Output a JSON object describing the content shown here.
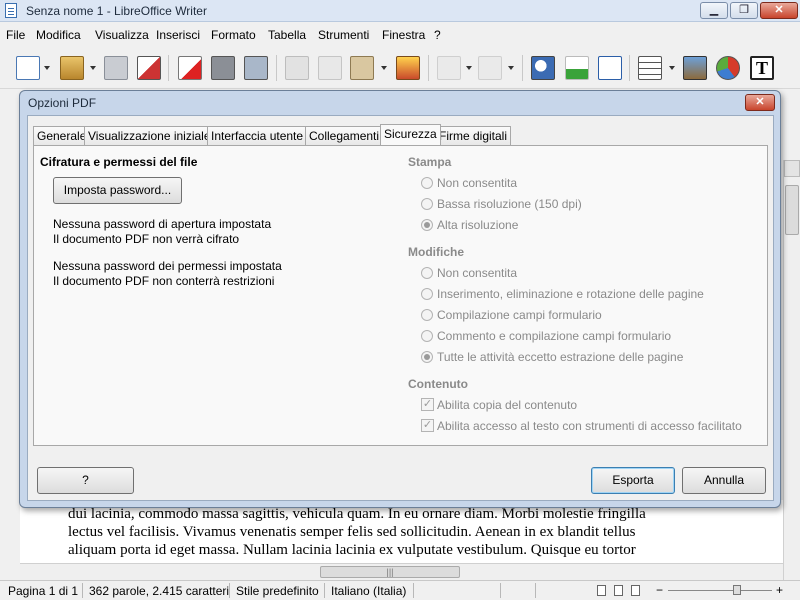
{
  "window": {
    "title": "Senza nome 1 - LibreOffice Writer",
    "minimize": "▁",
    "maximize": "❐",
    "close": "✕"
  },
  "menu": [
    "File",
    "Modifica",
    "Visualizza",
    "Inserisci",
    "Formato",
    "Tabella",
    "Strumenti",
    "Finestra",
    "?"
  ],
  "toolbar_icons": [
    "new-document-icon",
    "open-icon",
    "save-icon",
    "edit-file-icon",
    "export-pdf-icon",
    "print-icon",
    "print-preview-icon",
    "cut-icon",
    "copy-icon",
    "paste-icon",
    "clone-formatting-icon",
    "undo-icon",
    "redo-icon",
    "find-replace-icon",
    "spellcheck-icon",
    "formatting-marks-icon",
    "table-icon",
    "image-icon",
    "chart-icon",
    "text-box-icon"
  ],
  "document": {
    "lines": [
      "dui lacinia, commodo massa sagittis, vehicula quam. In eu ornare diam. Morbi molestie fringilla",
      "lectus vel facilisis. Vivamus venenatis semper felis sed sollicitudin. Aenean in ex blandit tellus",
      "aliquam porta id eget massa. Nullam lacinia lacinia ex vulputate vestibulum. Quisque eu tortor"
    ]
  },
  "statusbar": {
    "page": "Pagina 1 di 1",
    "words": "362 parole, 2.415 caratteri",
    "style": "Stile predefinito",
    "language": "Italiano (Italia)",
    "zoom_minus": "−",
    "zoom_plus": "+"
  },
  "dialog": {
    "title": "Opzioni PDF",
    "close": "✕",
    "tabs": [
      "Generale",
      "Visualizzazione iniziale",
      "Interfaccia utente",
      "Collegamenti",
      "Sicurezza",
      "Firme digitali"
    ],
    "active_tab": "Sicurezza",
    "encryption": {
      "heading": "Cifratura e permessi del file",
      "set_password_button": "Imposta password...",
      "open_password_status": "Nessuna password di apertura impostata",
      "open_password_note": "Il documento PDF non verrà cifrato",
      "permission_password_status": "Nessuna password dei permessi impostata",
      "permission_password_note": "Il documento PDF non conterrà restrizioni"
    },
    "printing": {
      "heading": "Stampa",
      "options": [
        {
          "label": "Non consentita",
          "checked": false
        },
        {
          "label": "Bassa risoluzione (150 dpi)",
          "checked": false
        },
        {
          "label": "Alta risoluzione",
          "checked": true
        }
      ]
    },
    "changes": {
      "heading": "Modifiche",
      "options": [
        {
          "label": "Non consentita",
          "checked": false
        },
        {
          "label": "Inserimento, eliminazione e rotazione delle pagine",
          "checked": false
        },
        {
          "label": "Compilazione campi formulario",
          "checked": false
        },
        {
          "label": "Commento e compilazione campi formulario",
          "checked": false
        },
        {
          "label": "Tutte le attività eccetto estrazione delle pagine",
          "checked": true
        }
      ]
    },
    "content": {
      "heading": "Contenuto",
      "options": [
        {
          "label": "Abilita copia del contenuto",
          "checked": true
        },
        {
          "label": "Abilita accesso al testo con strumenti di accesso facilitato",
          "checked": true
        }
      ]
    },
    "help_button": "?",
    "export_button": "Esporta",
    "cancel_button": "Annulla"
  },
  "colors": {
    "title_bar": "#dce6f4",
    "dialog_frame": "#c7d6ea",
    "close_red": "#c8442c",
    "disabled_text": "#8a8a8a"
  }
}
